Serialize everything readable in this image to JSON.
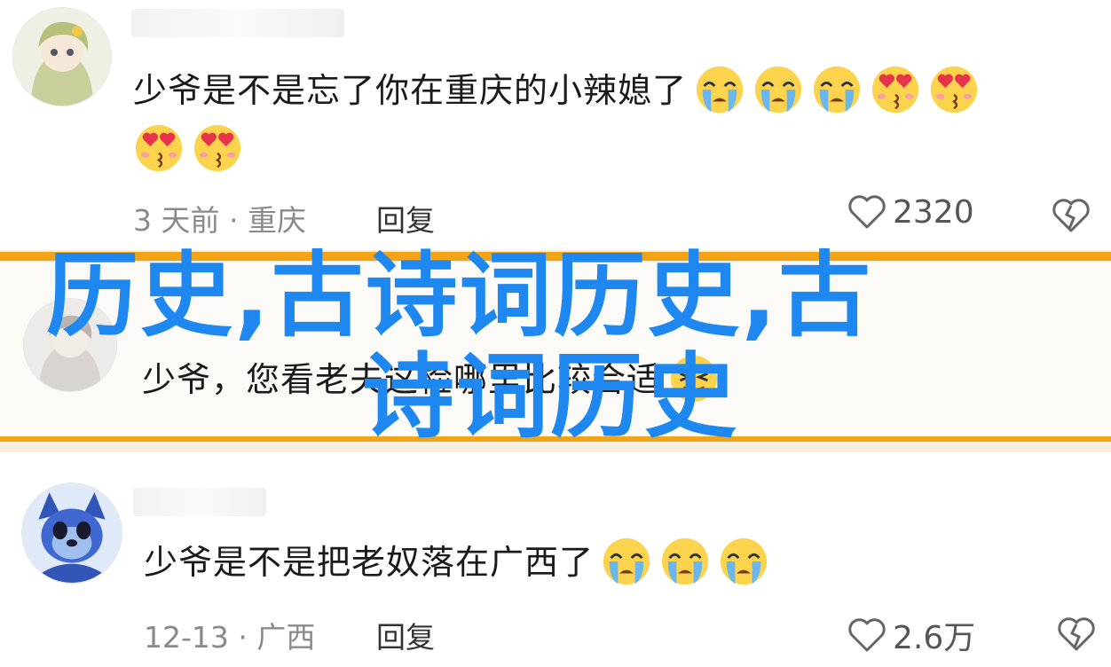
{
  "comments": [
    {
      "text": "少爷是不是忘了你在重庆的小辣媳了",
      "emoji_row1": [
        "crying-face",
        "crying-face",
        "crying-face",
        "heart-eyes-face",
        "heart-eyes-face"
      ],
      "emoji_row2": [
        "heart-eyes-face",
        "heart-eyes-face"
      ],
      "meta": "3 天前 · 重庆",
      "reply": "回复",
      "likes": "2320"
    },
    {
      "text": "少爷，您看老夫这检哪里比较合适",
      "emoji": [
        "tongue-face"
      ]
    },
    {
      "text": "少爷是不是把老奴落在广西了",
      "emoji": [
        "crying-face",
        "crying-face",
        "crying-face"
      ],
      "meta": "12-13 · 广西",
      "reply": "回复",
      "likes": "2.6万"
    }
  ],
  "overlay": {
    "line1": "历史,古诗词历史,古",
    "line2": "诗词历史"
  },
  "colors": {
    "accent_band": "#f3a316",
    "overlay_text": "#1e88f0",
    "meta_text": "#8a8a8a"
  }
}
